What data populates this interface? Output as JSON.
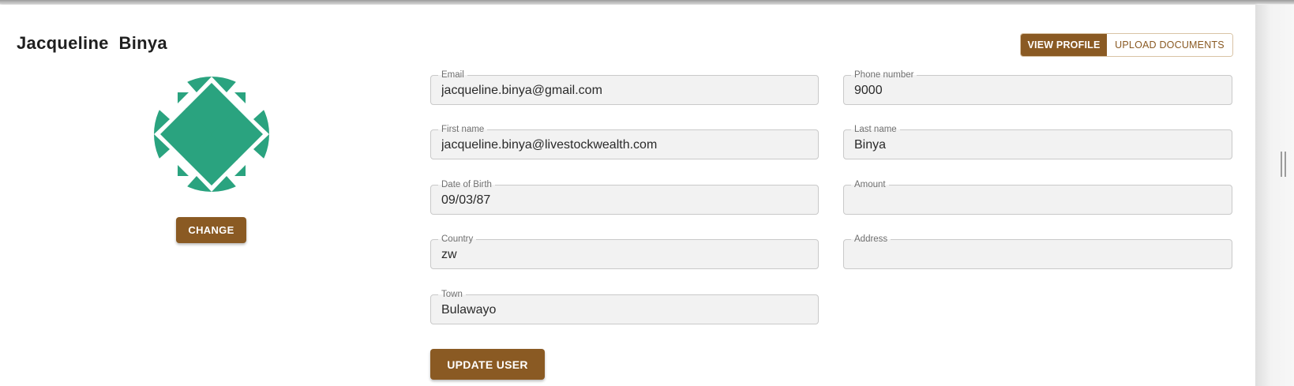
{
  "user": {
    "first_name": "Jacqueline",
    "last_name": "Binya"
  },
  "avatar": {
    "accent_color": "#2aa37f"
  },
  "buttons": {
    "change_label": "CHANGE",
    "update_label": "UPDATE USER"
  },
  "tabs": [
    {
      "label": "VIEW PROFILE",
      "active": true
    },
    {
      "label": "UPLOAD DOCUMENTS",
      "active": false
    }
  ],
  "fields": {
    "email": {
      "label": "Email",
      "value": "jacqueline.binya@gmail.com"
    },
    "phone": {
      "label": "Phone number",
      "value": "9000"
    },
    "first_name": {
      "label": "First name",
      "value": "jacqueline.binya@livestockwealth.com"
    },
    "last_name": {
      "label": "Last name",
      "value": "Binya"
    },
    "dob": {
      "label": "Date of Birth",
      "value": "09/03/87"
    },
    "amount": {
      "label": "Amount",
      "value": ""
    },
    "country": {
      "label": "Country",
      "value": "zw"
    },
    "address": {
      "label": "Address",
      "value": ""
    },
    "town": {
      "label": "Town",
      "value": "Bulawayo"
    }
  },
  "colors": {
    "brand": "#8a5a23",
    "field_background": "#f2f2f2",
    "avatar_green": "#2aa37f"
  }
}
